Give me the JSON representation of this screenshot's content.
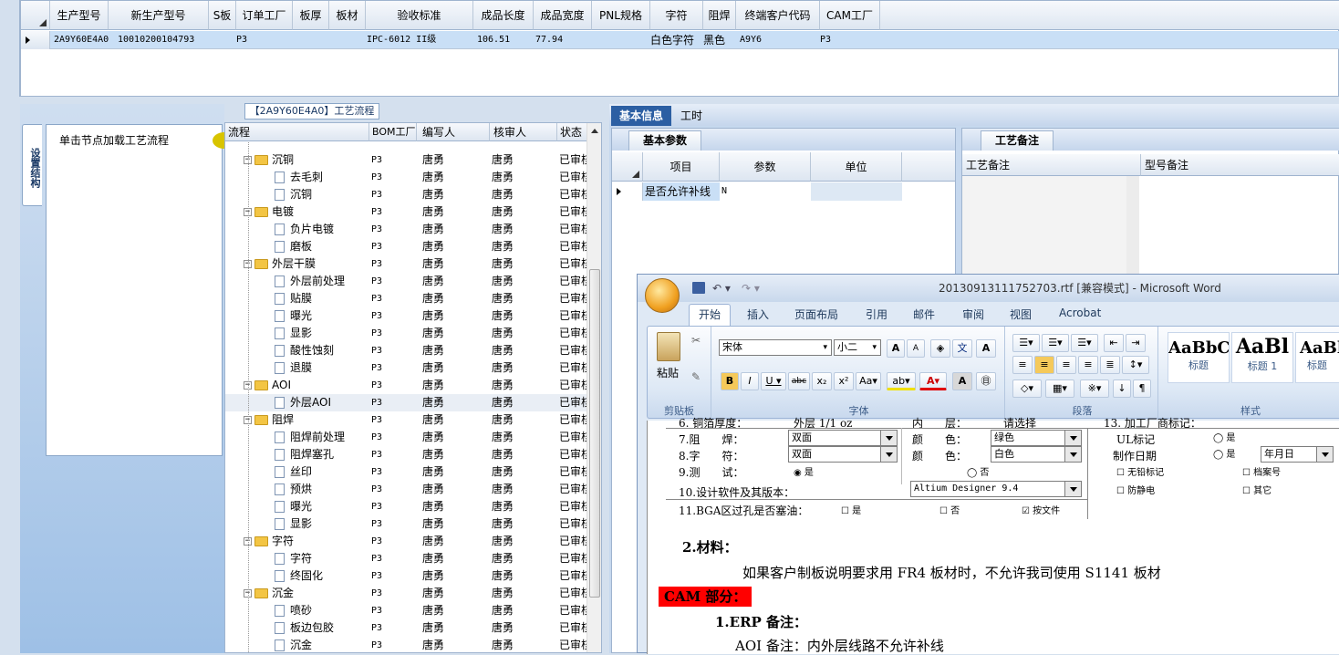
{
  "top_grid": {
    "columns": [
      "生产型号",
      "新生产型号",
      "S板",
      "订单工厂",
      "板厚",
      "板材",
      "验收标准",
      "成品长度",
      "成品宽度",
      "PNL规格",
      "字符",
      "阻焊",
      "终端客户代码",
      "CAM工厂"
    ],
    "row": {
      "c0": "2A9Y60E4A0",
      "c1": "10010200104793",
      "c3": "P3",
      "c6": "IPC-6012 II级",
      "c7": "106.51",
      "c8": "77.94",
      "c10": "白色字符",
      "c11": "黑色",
      "c12": "A9Y6",
      "c13": "P3"
    }
  },
  "process_title": "【2A9Y60E4A0】工艺流程",
  "left_panel": {
    "vtab": "设置结构",
    "load_text": "单击节点加载工艺流程"
  },
  "tree": {
    "headers": [
      "流程",
      "BOM工厂",
      "编写人",
      "核审人",
      "状态"
    ],
    "rows": [
      {
        "t": "f",
        "name": "沉铜",
        "f": "P3",
        "w": "唐勇",
        "c": "唐勇",
        "s": "已审核"
      },
      {
        "t": "d",
        "name": "去毛刺",
        "f": "P3",
        "w": "唐勇",
        "c": "唐勇",
        "s": "已审核"
      },
      {
        "t": "d",
        "name": "沉铜",
        "f": "P3",
        "w": "唐勇",
        "c": "唐勇",
        "s": "已审核"
      },
      {
        "t": "f",
        "name": "电镀",
        "f": "P3",
        "w": "唐勇",
        "c": "唐勇",
        "s": "已审核"
      },
      {
        "t": "d",
        "name": "负片电镀",
        "f": "P3",
        "w": "唐勇",
        "c": "唐勇",
        "s": "已审核"
      },
      {
        "t": "d",
        "name": "磨板",
        "f": "P3",
        "w": "唐勇",
        "c": "唐勇",
        "s": "已审核"
      },
      {
        "t": "f",
        "name": "外层干膜",
        "f": "P3",
        "w": "唐勇",
        "c": "唐勇",
        "s": "已审核"
      },
      {
        "t": "d",
        "name": "外层前处理",
        "f": "P3",
        "w": "唐勇",
        "c": "唐勇",
        "s": "已审核"
      },
      {
        "t": "d",
        "name": "贴膜",
        "f": "P3",
        "w": "唐勇",
        "c": "唐勇",
        "s": "已审核"
      },
      {
        "t": "d",
        "name": "曝光",
        "f": "P3",
        "w": "唐勇",
        "c": "唐勇",
        "s": "已审核"
      },
      {
        "t": "d",
        "name": "显影",
        "f": "P3",
        "w": "唐勇",
        "c": "唐勇",
        "s": "已审核"
      },
      {
        "t": "d",
        "name": "酸性蚀刻",
        "f": "P3",
        "w": "唐勇",
        "c": "唐勇",
        "s": "已审核"
      },
      {
        "t": "d",
        "name": "退膜",
        "f": "P3",
        "w": "唐勇",
        "c": "唐勇",
        "s": "已审核"
      },
      {
        "t": "f",
        "name": "AOI",
        "f": "P3",
        "w": "唐勇",
        "c": "唐勇",
        "s": "已审核"
      },
      {
        "t": "d",
        "name": "外层AOI",
        "f": "P3",
        "w": "唐勇",
        "c": "唐勇",
        "s": "已审核",
        "sel": true
      },
      {
        "t": "f",
        "name": "阻焊",
        "f": "P3",
        "w": "唐勇",
        "c": "唐勇",
        "s": "已审核"
      },
      {
        "t": "d",
        "name": "阻焊前处理",
        "f": "P3",
        "w": "唐勇",
        "c": "唐勇",
        "s": "已审核"
      },
      {
        "t": "d",
        "name": "阻焊塞孔",
        "f": "P3",
        "w": "唐勇",
        "c": "唐勇",
        "s": "已审核"
      },
      {
        "t": "d",
        "name": "丝印",
        "f": "P3",
        "w": "唐勇",
        "c": "唐勇",
        "s": "已审核"
      },
      {
        "t": "d",
        "name": "预烘",
        "f": "P3",
        "w": "唐勇",
        "c": "唐勇",
        "s": "已审核"
      },
      {
        "t": "d",
        "name": "曝光",
        "f": "P3",
        "w": "唐勇",
        "c": "唐勇",
        "s": "已审核"
      },
      {
        "t": "d",
        "name": "显影",
        "f": "P3",
        "w": "唐勇",
        "c": "唐勇",
        "s": "已审核"
      },
      {
        "t": "f",
        "name": "字符",
        "f": "P3",
        "w": "唐勇",
        "c": "唐勇",
        "s": "已审核"
      },
      {
        "t": "d",
        "name": "字符",
        "f": "P3",
        "w": "唐勇",
        "c": "唐勇",
        "s": "已审核"
      },
      {
        "t": "d",
        "name": "终固化",
        "f": "P3",
        "w": "唐勇",
        "c": "唐勇",
        "s": "已审核"
      },
      {
        "t": "f",
        "name": "沉金",
        "f": "P3",
        "w": "唐勇",
        "c": "唐勇",
        "s": "已审核"
      },
      {
        "t": "d",
        "name": "喷砂",
        "f": "P3",
        "w": "唐勇",
        "c": "唐勇",
        "s": "已审核"
      },
      {
        "t": "d",
        "name": "板边包胶",
        "f": "P3",
        "w": "唐勇",
        "c": "唐勇",
        "s": "已审核"
      },
      {
        "t": "d",
        "name": "沉金",
        "f": "P3",
        "w": "唐勇",
        "c": "唐勇",
        "s": "已审核"
      }
    ]
  },
  "right_tabs": [
    "基本信息",
    "工时"
  ],
  "basic_params": {
    "tab": "基本参数",
    "headers": [
      "项目",
      "参数",
      "单位"
    ],
    "row": {
      "item": "是否允许补线",
      "param": "N",
      "unit": ""
    }
  },
  "notes": {
    "tab": "工艺备注",
    "col1": "工艺备注",
    "col2": "型号备注"
  },
  "word": {
    "title": "20130913111752703.rtf [兼容模式] - Microsoft Word",
    "tabs": [
      "开始",
      "插入",
      "页面布局",
      "引用",
      "邮件",
      "审阅",
      "视图",
      "Acrobat"
    ],
    "clipboard": {
      "paste": "粘贴",
      "label": "剪贴板"
    },
    "font": {
      "name": "宋体",
      "size": "小二",
      "label": "字体"
    },
    "paragraph_label": "段落",
    "styles": {
      "label": "样式",
      "s1": "AaBbC",
      "s1_name": "标题",
      "s2": "AaBl",
      "s2_name": "标题 1",
      "s3": "AaBl",
      "s3_name": "标题"
    },
    "form": {
      "r_prev_l": "6. 铜箔厚度：",
      "r_prev_v": "外层 1/1 oz",
      "r_prev_c": "内　　层：",
      "r_prev_cv": "请选择",
      "r_prev_r": "13. 加工厂商标记：",
      "r7": "7.阻　　焊：",
      "r7v": "双面",
      "r7c": "颜　　色：",
      "r7cv": "绿色",
      "r7r": "UL标记",
      "r7opt": "是",
      "r8": "8.字　　符：",
      "r8v": "双面",
      "r8c": "颜　　色：",
      "r8cv": "白色",
      "r8r": "制作日期",
      "r8opt": "是",
      "r8sel": "年月日",
      "r9": "9.测　　试：",
      "r9a": "是",
      "r9b": "否",
      "r9c1": "无铅标记",
      "r9c2": "档案号",
      "r10": "10.设计软件及其版本：",
      "r10v": "Altium Designer 9.4",
      "r10c1": "防静电",
      "r10c2": "其它",
      "r11": "11.BGA区过孔是否塞油：",
      "r11a": "是",
      "r11b": "否",
      "r11c": "按文件"
    },
    "body": {
      "materials": "2.材料：",
      "materials_text": "如果客户制板说明要求用 FR4 板材时，不允许我司使用 S1141 板材",
      "cam": "CAM 部分：",
      "erp": "1.ERP 备注：",
      "aoi": "AOI 备注：内外层线路不允许补线"
    }
  },
  "colors": {
    "selected_row": "#c9dff6",
    "cam_highlight": "#ff0000",
    "tab_active": "#2c5fa3"
  }
}
